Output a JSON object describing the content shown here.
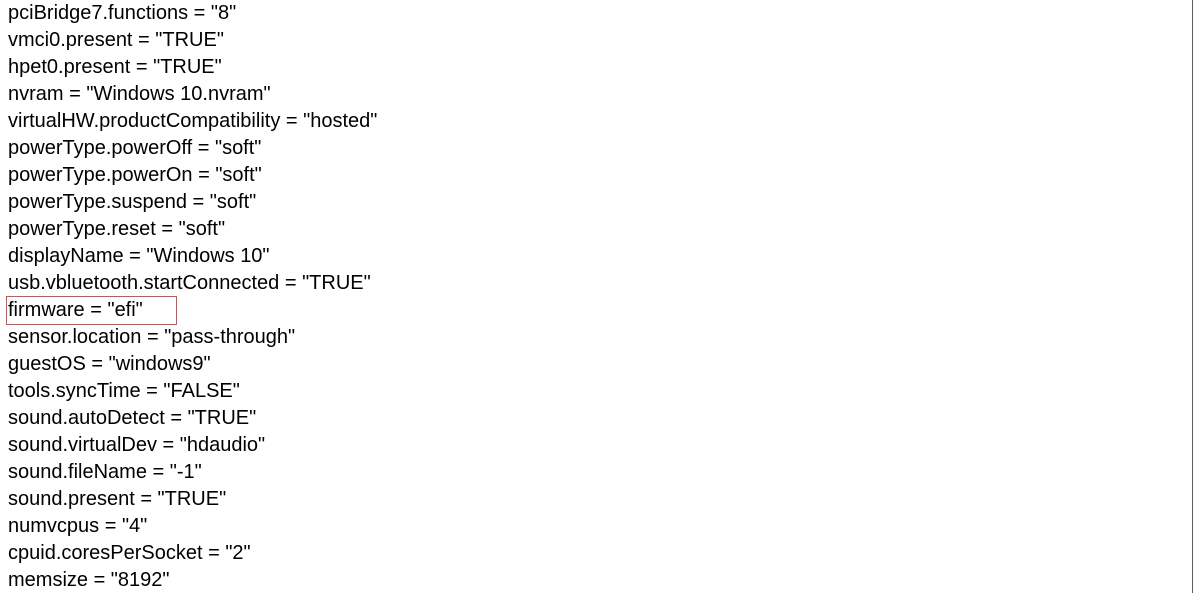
{
  "editor": {
    "lines": [
      "pciBridge7.functions = \"8\"",
      "vmci0.present = \"TRUE\"",
      "hpet0.present = \"TRUE\"",
      "nvram = \"Windows 10.nvram\"",
      "virtualHW.productCompatibility = \"hosted\"",
      "powerType.powerOff = \"soft\"",
      "powerType.powerOn = \"soft\"",
      "powerType.suspend = \"soft\"",
      "powerType.reset = \"soft\"",
      "displayName = \"Windows 10\"",
      "usb.vbluetooth.startConnected = \"TRUE\"",
      "firmware = \"efi\"",
      "sensor.location = \"pass-through\"",
      "guestOS = \"windows9\"",
      "tools.syncTime = \"FALSE\"",
      "sound.autoDetect = \"TRUE\"",
      "sound.virtualDev = \"hdaudio\"",
      "sound.fileName = \"-1\"",
      "sound.present = \"TRUE\"",
      "numvcpus = \"4\"",
      "cpuid.coresPerSocket = \"2\"",
      "memsize = \"8192\""
    ],
    "highlight_color": "#e34a4a"
  }
}
